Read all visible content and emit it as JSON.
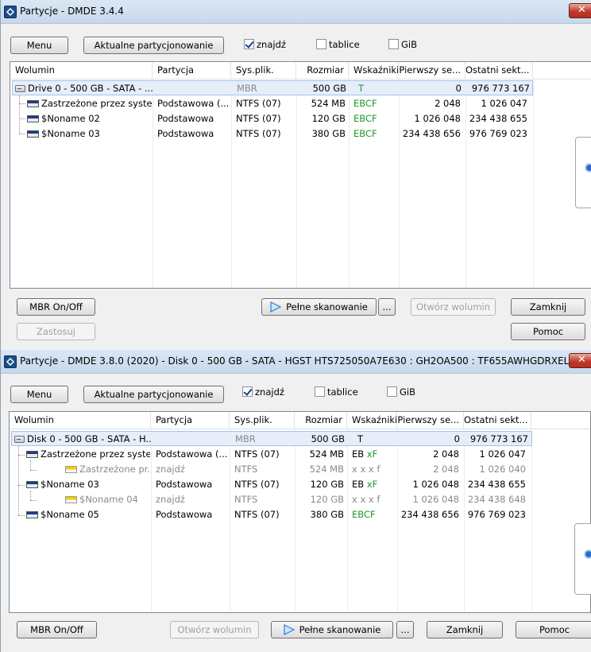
{
  "columns": [
    "Wolumin",
    "Partycja",
    "Sys.plik.",
    "Rozmiar",
    "Wskaźniki",
    "Pierwszy se...",
    "Ostatni sekt..."
  ],
  "w1": {
    "title": "Partycje - DMDE 3.4.4",
    "menu": "Menu",
    "current": "Aktualne partycjonowanie",
    "chk_find": "znajdź",
    "chk_tables": "tablice",
    "chk_gib": "GiB",
    "rows": [
      {
        "vol": "Drive 0 - 500 GB - SATA - ...",
        "part": "",
        "fs": "MBR",
        "size": "500 GB",
        "flags": "T",
        "first": "0",
        "last": "976 773 167"
      },
      {
        "vol": "Zastrzeżone przez system",
        "part": "Podstawowa (...",
        "fs": "NTFS (07)",
        "size": "524 MB",
        "flags": "EBCF",
        "first": "2 048",
        "last": "1 026 047"
      },
      {
        "vol": "$Noname 02",
        "part": "Podstawowa",
        "fs": "NTFS (07)",
        "size": "120 GB",
        "flags": "EBCF",
        "first": "1 026 048",
        "last": "234 438 655"
      },
      {
        "vol": "$Noname 03",
        "part": "Podstawowa",
        "fs": "NTFS (07)",
        "size": "380 GB",
        "flags": "EBCF",
        "first": "234 438 656",
        "last": "976 769 023"
      }
    ],
    "btn_mbr": "MBR On/Off",
    "btn_scan": "Pełne skanowanie",
    "btn_dots": "...",
    "btn_open": "Otwórz wolumin",
    "btn_close": "Zamknij",
    "btn_apply": "Zastosuj",
    "btn_help": "Pomoc"
  },
  "w2": {
    "title": "Partycje - DMDE 3.8.0 (2020) - Disk 0 - 500 GB - SATA - HGST HTS725050A7E630 : GH2OA500 : TF655AWHGDRXEL",
    "menu": "Menu",
    "current": "Aktualne partycjonowanie",
    "chk_find": "znajdź",
    "chk_tables": "tablice",
    "chk_gib": "GiB",
    "rows": [
      {
        "vol": "Disk 0 - 500 GB - SATA - H...",
        "part": "",
        "fs": "MBR",
        "size": "500 GB",
        "flags_a": "T",
        "flags_b": "",
        "first": "0",
        "last": "976 773 167"
      },
      {
        "vol": "Zastrzeżone przez system",
        "part": "Podstawowa (...",
        "fs": "NTFS (07)",
        "size": "524 MB",
        "flags_a": "EB",
        "flags_b": "xF",
        "first": "2 048",
        "last": "1 026 047"
      },
      {
        "vol": "Zastrzeżone pr...",
        "part": "znajdź",
        "fs": "NTFS",
        "size": "524 MB",
        "flags_a": "x x x f",
        "flags_b": "",
        "first": "2 048",
        "last": "1 026 040"
      },
      {
        "vol": "$Noname 03",
        "part": "Podstawowa",
        "fs": "NTFS (07)",
        "size": "120 GB",
        "flags_a": "EB",
        "flags_b": "xF",
        "first": "1 026 048",
        "last": "234 438 655"
      },
      {
        "vol": "$Noname 04",
        "part": "znajdź",
        "fs": "NTFS",
        "size": "120 GB",
        "flags_a": "x x x f",
        "flags_b": "",
        "first": "1 026 048",
        "last": "234 438 648"
      },
      {
        "vol": "$Noname 05",
        "part": "Podstawowa",
        "fs": "NTFS (07)",
        "size": "380 GB",
        "flags_a": "",
        "flags_b": "EBCF",
        "first": "234 438 656",
        "last": "976 769 023"
      }
    ],
    "btn_mbr": "MBR On/Off",
    "btn_open": "Otwórz wolumin",
    "btn_scan": "Pełne skanowanie",
    "btn_dots": "...",
    "btn_close": "Zamknij",
    "btn_help": "Pomoc"
  }
}
